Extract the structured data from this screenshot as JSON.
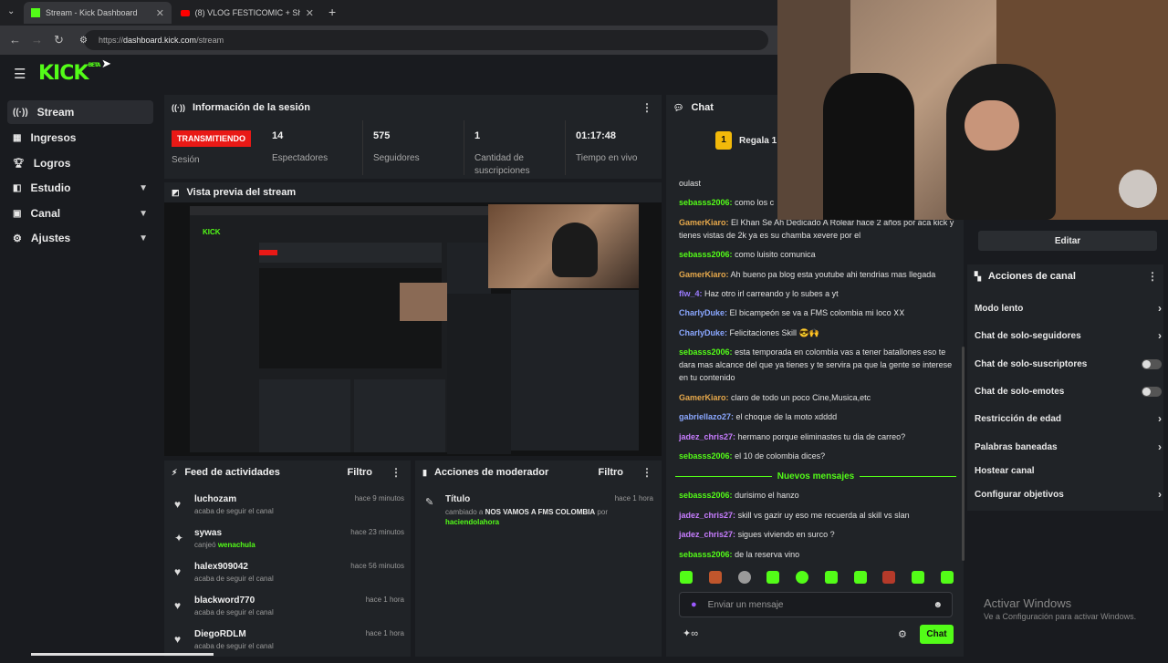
{
  "browser": {
    "tabs": [
      {
        "label": "Stream - Kick Dashboard"
      },
      {
        "label": "(8) VLOG FESTICOMIC + Show ..."
      }
    ],
    "url_prefix": "https://",
    "url_host": "dashboard.kick.com",
    "url_path": "/stream"
  },
  "header": {
    "logo": "KICK",
    "beta": "BETA"
  },
  "sidebar": {
    "items": [
      {
        "label": "Stream"
      },
      {
        "label": "Ingresos"
      },
      {
        "label": "Logros"
      },
      {
        "label": "Estudio"
      },
      {
        "label": "Canal"
      },
      {
        "label": "Ajustes"
      }
    ]
  },
  "session": {
    "title": "Información de la sesión",
    "status_badge": "TRANSMITIENDO",
    "status_label": "Sesión",
    "stats": [
      {
        "value": "14",
        "label": "Espectadores"
      },
      {
        "value": "575",
        "label": "Seguidores"
      },
      {
        "value": "1",
        "label": "Cantidad de suscripciones"
      },
      {
        "value": "01:17:48",
        "label": "Tiempo en vivo"
      }
    ]
  },
  "preview": {
    "title": "Vista previa del stream"
  },
  "activity": {
    "title": "Feed de actividades",
    "filter": "Filtro",
    "items": [
      {
        "user": "luchozam",
        "action": "acaba de seguir el canal",
        "time": "hace 9 minutos",
        "extra": ""
      },
      {
        "user": "sywas",
        "action": "canjeó",
        "time": "hace 23 minutos",
        "extra": "wenachula"
      },
      {
        "user": "halex909042",
        "action": "acaba de seguir el canal",
        "time": "hace 56 minutos",
        "extra": ""
      },
      {
        "user": "blackword770",
        "action": "acaba de seguir el canal",
        "time": "hace 1 hora",
        "extra": ""
      },
      {
        "user": "DiegoRDLM",
        "action": "acaba de seguir el canal",
        "time": "hace 1 hora",
        "extra": ""
      }
    ]
  },
  "moderator": {
    "title": "Acciones de moderador",
    "filter": "Filtro",
    "item": {
      "heading": "Título",
      "time": "hace 1 hora",
      "prefix": "cambiado a",
      "value": "NOS VAMOS A FMS COLOMBIA",
      "by": "por",
      "user": "haciendolahora"
    }
  },
  "chat": {
    "title": "Chat",
    "gift": "Regala 1 s",
    "messages": [
      {
        "user": "",
        "text": "oulast",
        "color": "#53fc18"
      },
      {
        "user": "sebasss2006:",
        "text": "como los c",
        "color": "#53fc18"
      },
      {
        "user": "GamerKiaro:",
        "text": "El Khan Se Ah Dedicado A Rolear hace 2 años por aca kick y tienes vistas de 2k ya es su chamba xevere por el",
        "color": "#e6a84b"
      },
      {
        "user": "sebasss2006:",
        "text": "como luisito comunica",
        "color": "#53fc18"
      },
      {
        "user": "GamerKiaro:",
        "text": "Ah bueno pa blog esta youtube ahi tendrias mas llegada",
        "color": "#e6a84b"
      },
      {
        "user": "flw_4:",
        "text": "Haz otro irl carreando y lo subes a yt",
        "color": "#9b7bff"
      },
      {
        "user": "CharlyDuke:",
        "text": "El bicampeón se va a FMS colombia mi loco 𐌢𐌢",
        "color": "#8aa7ff"
      },
      {
        "user": "CharlyDuke:",
        "text": "Felicitaciones Skill 😎🙌",
        "color": "#8aa7ff"
      },
      {
        "user": "sebasss2006:",
        "text": "esta temporada en colombia vas a tener batallones eso te dara mas alcance del que ya tienes y te servira pa que la gente se interese en tu contenido",
        "color": "#53fc18"
      },
      {
        "user": "GamerKiaro:",
        "text": "claro de todo un poco Cine,Musica,etc",
        "color": "#e6a84b"
      },
      {
        "user": "gabriellazo27:",
        "text": "el choque de la moto xdddd",
        "color": "#8aa7ff"
      },
      {
        "user": "jadez_chris27:",
        "text": "hermano porque eliminastes tu dia de carreo?",
        "color": "#c77dff"
      },
      {
        "user": "sebasss2006:",
        "text": "el 10 de colombia dices?",
        "color": "#53fc18"
      }
    ],
    "new_messages_label": "Nuevos mensajes",
    "new_messages": [
      {
        "user": "sebasss2006:",
        "text": "durisimo el hanzo",
        "color": "#53fc18"
      },
      {
        "user": "jadez_chris27:",
        "text": "skill vs gazir uy eso me recuerda al skill vs slan",
        "color": "#c77dff"
      },
      {
        "user": "jadez_chris27:",
        "text": "sigues viviendo en surco ?",
        "color": "#c77dff"
      },
      {
        "user": "sebasss2006:",
        "text": "de la reserva vino",
        "color": "#53fc18"
      }
    ],
    "input_placeholder": "Enviar un mensaje",
    "send_label": "Chat"
  },
  "channel_actions": {
    "edit_label": "Editar",
    "title": "Acciones de canal",
    "items": [
      {
        "label": "Modo lento",
        "control": "chevron"
      },
      {
        "label": "Chat de solo-seguidores",
        "control": "chevron"
      },
      {
        "label": "Chat de solo-suscriptores",
        "control": "toggle"
      },
      {
        "label": "Chat de solo-emotes",
        "control": "toggle"
      },
      {
        "label": "Restricción de edad",
        "control": "chevron"
      },
      {
        "label": "Palabras baneadas",
        "control": "chevron"
      },
      {
        "label": "Hostear canal",
        "control": "none"
      },
      {
        "label": "Configurar objetivos",
        "control": "chevron"
      }
    ]
  },
  "watermark": {
    "line1": "Activar Windows",
    "line2": "Ve a Configuración para activar Windows."
  },
  "colors": {
    "accent": "#53fc18",
    "live": "#e91916",
    "background": "#191b1f",
    "panel": "#202327"
  }
}
